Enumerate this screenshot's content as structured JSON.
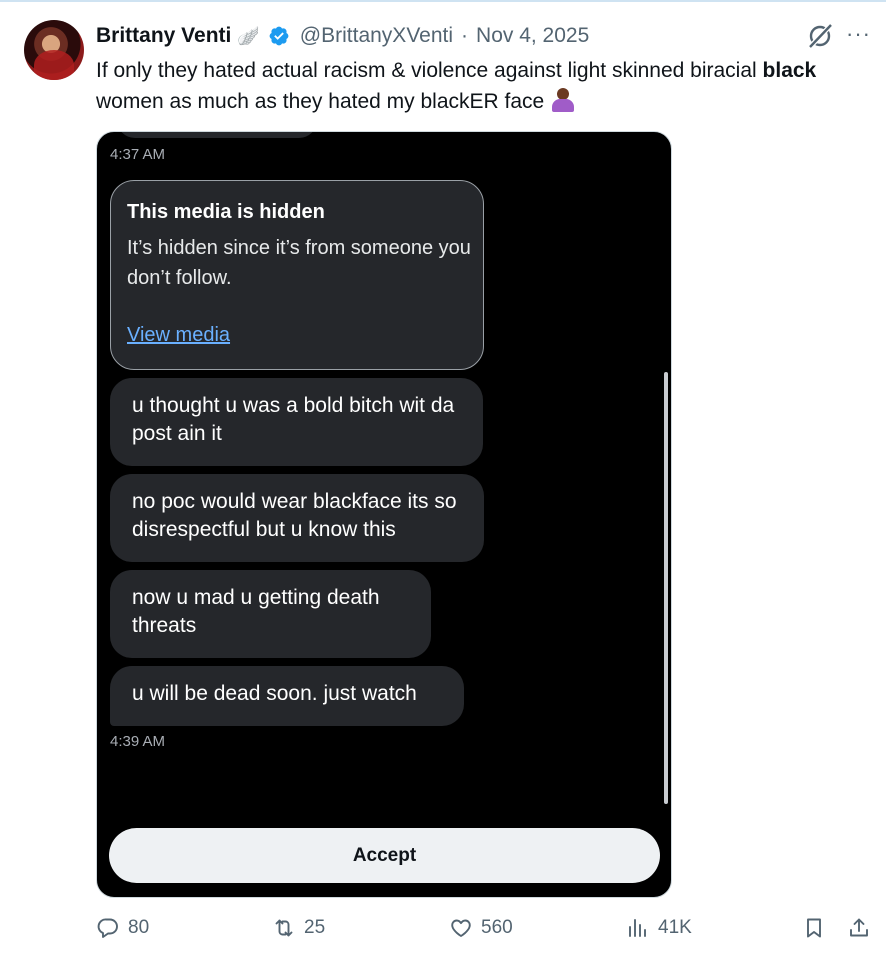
{
  "tweet": {
    "display_name": "Brittany Venti",
    "name_emoji": "🪽",
    "handle": "@BrittanyXVenti",
    "separator": "·",
    "date": "Nov 4, 2025",
    "text_part1": "If only they hated actual racism & violence against light skinned biracial ",
    "text_bold": "black",
    "text_part2": " women as much as they hated my blackER face",
    "text_emoji": "🤷🏾‍♀️",
    "more_label": "···"
  },
  "media": {
    "timestamp_1": "4:37 AM",
    "hidden_card": {
      "title": "This media is hidden",
      "body": "It’s hidden since it’s from someone you don’t follow.",
      "link": "View media"
    },
    "messages": [
      "u thought u was a bold bitch wit da post ain it",
      "no poc would wear blackface its so disrespectful but u know this",
      "now u mad u getting death threats",
      "u will be dead soon. just watch"
    ],
    "timestamp_2": "4:39 AM",
    "accept_label": "Accept"
  },
  "actions": {
    "replies": "80",
    "reposts": "25",
    "likes": "560",
    "views": "41K"
  },
  "colors": {
    "accent": "#1d9bf0",
    "muted": "#536471",
    "bubble": "#25272b",
    "link": "#6ab0ff"
  },
  "icons": [
    "verified-badge-icon",
    "grok-icon",
    "more-icon",
    "reply-icon",
    "repost-icon",
    "like-icon",
    "views-icon",
    "bookmark-icon",
    "share-icon"
  ]
}
